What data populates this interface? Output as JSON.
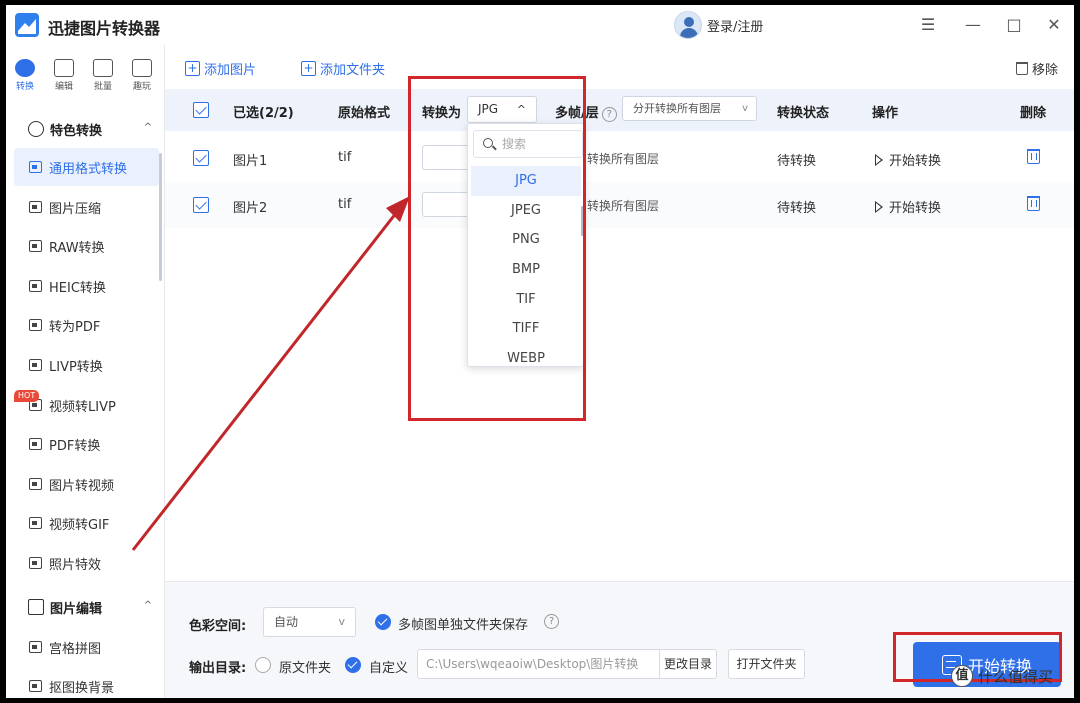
{
  "app": {
    "title": "迅捷图片转换器",
    "login": "登录/注册"
  },
  "window_controls": {
    "menu": "☰",
    "minimize": "—",
    "maximize": "□",
    "close": "✕"
  },
  "rail": [
    {
      "label": "转换",
      "icon": "convert-icon",
      "active": true
    },
    {
      "label": "编辑",
      "icon": "edit-icon"
    },
    {
      "label": "批量",
      "icon": "batch-icon"
    },
    {
      "label": "趣玩",
      "icon": "fun-icon"
    }
  ],
  "sidebar": {
    "section1": "特色转换",
    "items": [
      "通用格式转换",
      "图片压缩",
      "RAW转换",
      "HEIC转换",
      "转为PDF",
      "LIVP转换",
      "视频转LIVP",
      "PDF转换",
      "图片转视频",
      "视频转GIF",
      "照片特效"
    ],
    "hot_badge": "HOT",
    "section2": "图片编辑",
    "items2": [
      "宫格拼图",
      "抠图换背景"
    ]
  },
  "toolbar": {
    "add_image": "添加图片",
    "add_folder": "添加文件夹",
    "remove": "移除"
  },
  "table": {
    "headers": {
      "selected": "已选(2/2)",
      "orig_format": "原始格式",
      "convert_to": "转换为",
      "multi_frame": "多帧/层",
      "status": "转换状态",
      "action": "操作",
      "delete": "删除"
    },
    "format_value": "JPG",
    "layer_value": "分开转换所有图层",
    "rows": [
      {
        "name": "图片1",
        "format": "tif",
        "layer": "转换所有图层",
        "status": "待转换",
        "action": "开始转换"
      },
      {
        "name": "图片2",
        "format": "tif",
        "layer": "转换所有图层",
        "status": "待转换",
        "action": "开始转换"
      }
    ]
  },
  "dropdown": {
    "search_placeholder": "搜索",
    "options": [
      "JPG",
      "JPEG",
      "PNG",
      "BMP",
      "TIF",
      "TIFF",
      "WEBP"
    ],
    "selected": "JPG"
  },
  "bottom": {
    "color_space_label": "色彩空间:",
    "color_space_value": "自动",
    "multi_folder_label": "多帧图单独文件夹保存",
    "output_label": "输出目录:",
    "orig_folder": "原文件夹",
    "custom": "自定义",
    "path": "C:\\Users\\wqeaoiw\\Desktop\\图片转换",
    "change_dir": "更改目录",
    "open_folder": "打开文件夹",
    "start": "开始转换"
  },
  "watermark": {
    "text": "什么值得买",
    "glyph": "值"
  },
  "colors": {
    "accent": "#2f6fe8",
    "annotation": "#d3262a",
    "header_bg": "#eef3fb"
  }
}
